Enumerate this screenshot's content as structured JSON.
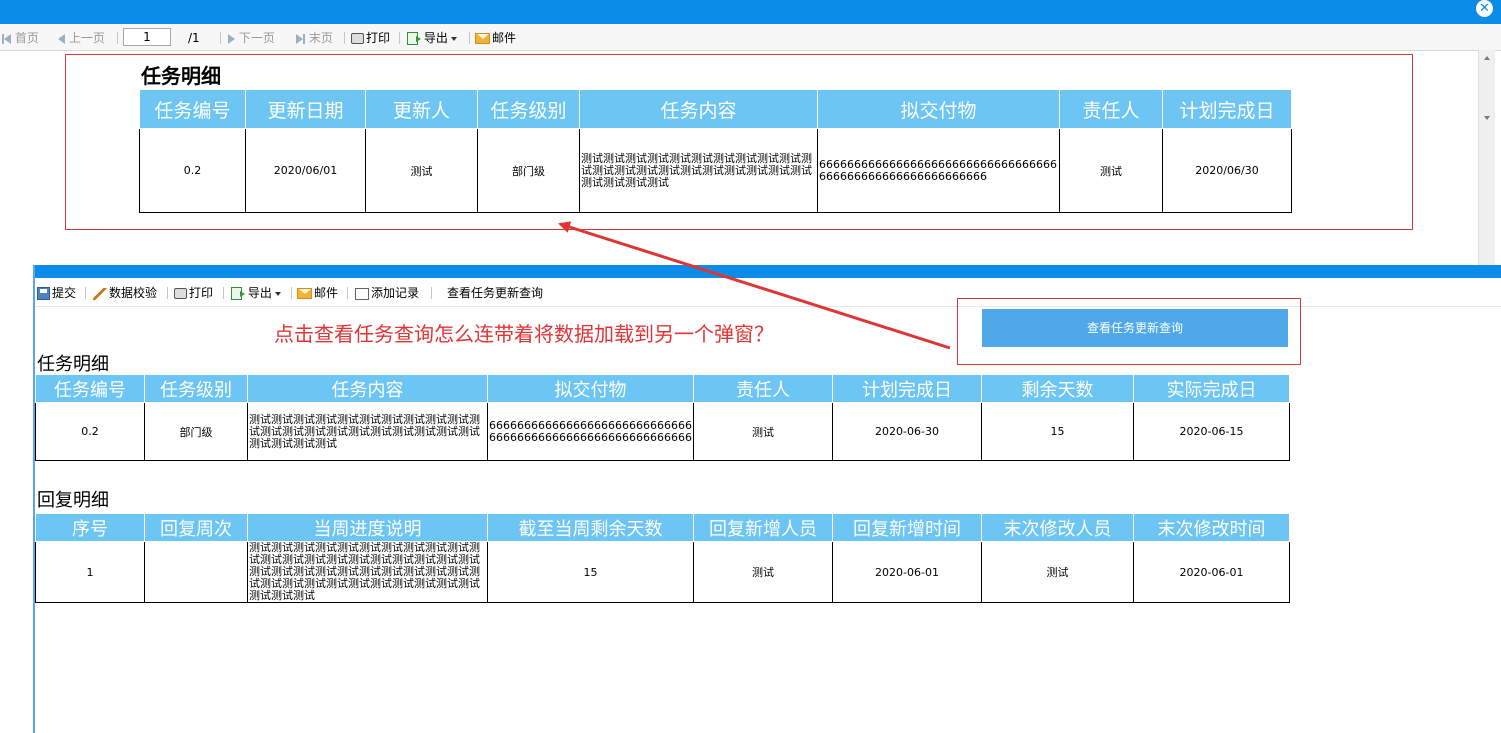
{
  "outer": {
    "close_glyph": "✕",
    "toolbar": {
      "first": "首页",
      "prev": "上一页",
      "page_value": "1",
      "page_total": "/1",
      "next": "下一页",
      "last": "末页",
      "print": "打印",
      "export": "导出",
      "mail": "邮件"
    },
    "report": {
      "title": "任务明细",
      "headers": [
        "任务编号",
        "更新日期",
        "更新人",
        "任务级别",
        "任务内容",
        "拟交付物",
        "责任人",
        "计划完成日"
      ],
      "row": [
        "0.2",
        "2020/06/01",
        "测试",
        "部门级",
        "测试测试测试测试测试测试测试测试测试测试测试测试测试测试测试测试测试测试测试测试测试测试测试测试测试",
        "6666666666666666666666666666666666666666666666666666666666",
        "测试",
        "2020/06/30"
      ]
    }
  },
  "inner": {
    "toolbar": {
      "submit": "提交",
      "validate": "数据校验",
      "print": "打印",
      "export": "导出",
      "mail": "邮件",
      "add_record": "添加记录",
      "query_link": "查看任务更新查询"
    },
    "question": "点击查看任务查询怎么连带着将数据加载到另一个弹窗？",
    "query_button": "查看任务更新查询",
    "task_section": {
      "title": "任务明细",
      "headers": [
        "任务编号",
        "任务级别",
        "任务内容",
        "拟交付物",
        "责任人",
        "计划完成日",
        "剩余天数",
        "实际完成日"
      ],
      "row": [
        "0.2",
        "部门级",
        "测试测试测试测试测试测试测试测试测试测试测试测试测试测试测试测试测试测试测试测试测试测试测试测试测试",
        "6666666666666666666666666666666666666666666666666666666666",
        "测试",
        "2020-06-30",
        "15",
        "2020-06-15"
      ]
    },
    "reply_section": {
      "title": "回复明细",
      "headers": [
        "序号",
        "回复周次",
        "当周进度说明",
        "截至当周剩余天数",
        "回复新增人员",
        "回复新增时间",
        "末次修改人员",
        "末次修改时间"
      ],
      "row": [
        "1",
        "",
        "测试测试测试测试测试测试测试测试测试测试测试测试测试测试测试测试测试测试测试测试测试测试测试测试测试测试测试测试测试测试测试测试测试测试测试测试测试测试测试测试测试测试测试测试测试",
        "15",
        "测试",
        "2020-06-01",
        "测试",
        "2020-06-01"
      ]
    }
  },
  "colors": {
    "titlebar": "#0c8ce9",
    "header_cell": "#6dc5f4",
    "annotation_red": "#e03535",
    "query_button": "#4ea8ea"
  }
}
